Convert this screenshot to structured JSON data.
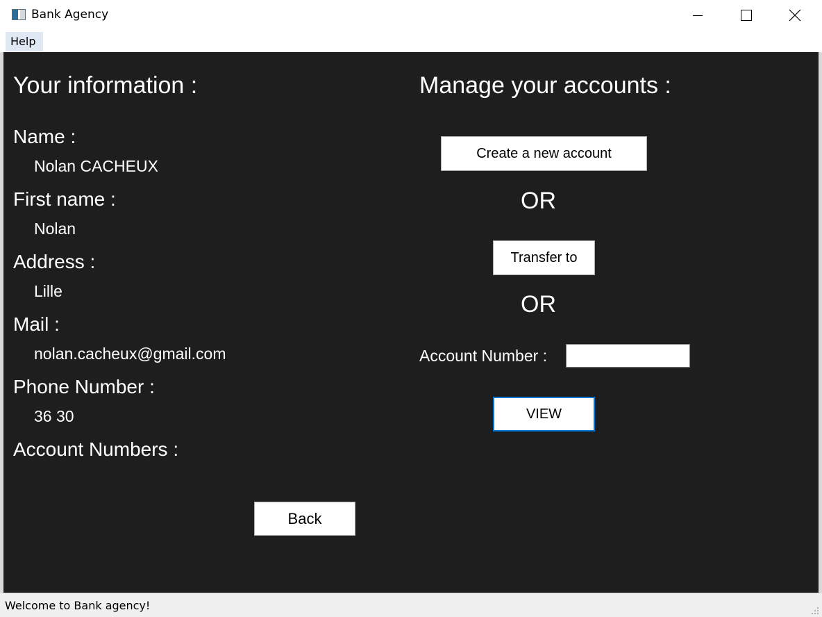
{
  "window": {
    "title": "Bank Agency",
    "controls": [
      "minimize-icon",
      "maximize-icon",
      "close-icon"
    ]
  },
  "menu": {
    "help": "Help"
  },
  "info": {
    "heading": "Your information :",
    "name_label": "Name :",
    "name_value": "Nolan CACHEUX",
    "first_name_label": "First name :",
    "first_name_value": "Nolan",
    "address_label": "Address :",
    "address_value": "Lille",
    "mail_label": "Mail :",
    "mail_value": "nolan.cacheux@gmail.com",
    "phone_label": "Phone Number :",
    "phone_value": "36 30",
    "accounts_label": "Account Numbers :"
  },
  "manage": {
    "heading": "Manage your accounts :",
    "create_button": "Create a new account",
    "or_1": "OR",
    "transfer_button": "Transfer to",
    "or_2": "OR",
    "account_number_label": "Account Number :",
    "account_number_value": "",
    "view_button": "VIEW"
  },
  "back_button": "Back",
  "status": {
    "text": "Welcome to Bank agency!"
  },
  "colors": {
    "panel_background": "#1e1e1e",
    "text": "#ffffff",
    "focus_border": "#0078d7"
  }
}
